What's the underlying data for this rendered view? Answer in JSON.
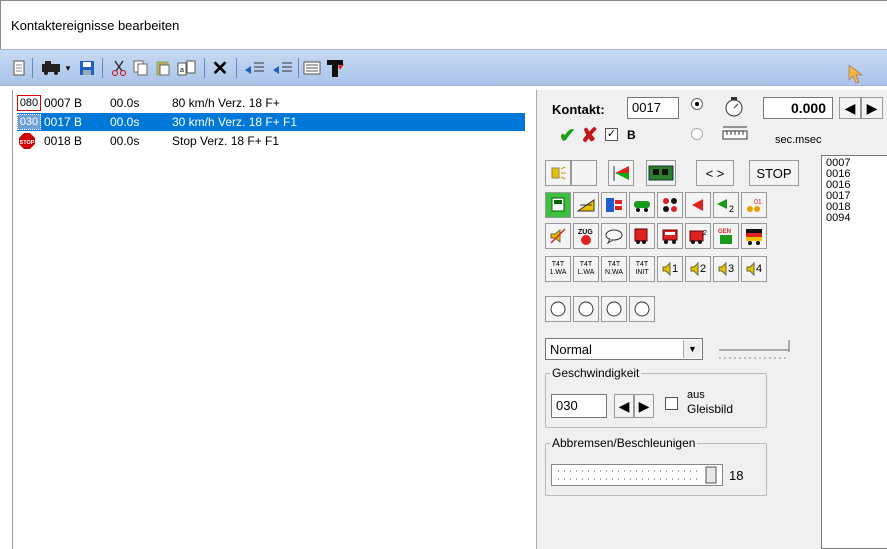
{
  "window": {
    "title": "Kontaktereignisse bearbeiten"
  },
  "toolbar": {
    "icons": [
      "new-icon",
      "train-icon",
      "dropdown-arrow-icon",
      "save-icon",
      "cut-icon",
      "copy-icon",
      "paste-icon",
      "paste-special-icon",
      "delete-icon",
      "indent-icon",
      "outdent-icon",
      "list-icon",
      "t-icon"
    ]
  },
  "events": [
    {
      "icon_text": "080",
      "contact": "0007 B",
      "time": "00.0s",
      "desc": "80 km/h Verz. 18 F+"
    },
    {
      "icon_text": "030",
      "contact": "0017 B",
      "time": "00.0s",
      "desc": "30 km/h Verz. 18 F+ F1"
    },
    {
      "icon_text": "STOP",
      "contact": "0018 B",
      "time": "00.0s",
      "desc": "Stop Verz. 18 F+ F1"
    }
  ],
  "panel": {
    "kontakt_label": "Kontakt:",
    "kontakt_value": "0017",
    "time_value": "0.000",
    "b_label": "B",
    "unit_label": "sec.msec",
    "stop_label": "STOP",
    "arrows_label": "< >",
    "contact_list": [
      "0007",
      "0016",
      "0016",
      "0017",
      "0018",
      "0094"
    ],
    "t4t_labels": [
      "T4T\n1.WA",
      "T4T\nL.WA",
      "T4T\nN.WA",
      "T4T\nINIT"
    ],
    "speaker_labels": [
      "1",
      "2",
      "3",
      "4"
    ],
    "mode_select": "Normal",
    "speed_group": "Geschwindigkeit",
    "speed_value": "030",
    "aus_label": "aus",
    "gleisbild_label": "Gleisbild",
    "brake_group": "Abbremsen/Beschleunigen",
    "brake_value": "18"
  }
}
